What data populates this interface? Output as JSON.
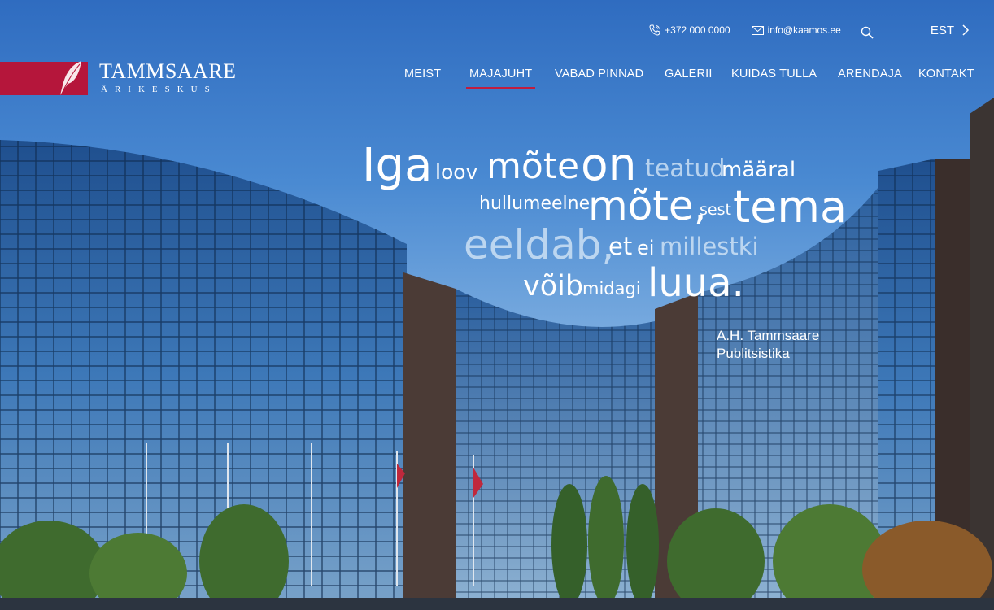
{
  "topbar": {
    "phone": "+372 000 0000",
    "email": "info@kaamos.ee",
    "language": "EST"
  },
  "logo": {
    "title": "TAMMSAARE",
    "subtitle": "ÄRIKESKUS",
    "accent_color": "#b5163b"
  },
  "nav": {
    "items": [
      {
        "label": "MEIST",
        "active": false
      },
      {
        "label": "MAJAJUHT",
        "active": true
      },
      {
        "label": "VABAD PINNAD",
        "active": false
      },
      {
        "label": "GALERII",
        "active": false
      },
      {
        "label": "KUIDAS TULLA",
        "active": false
      },
      {
        "label": "ARENDAJA",
        "active": false
      },
      {
        "label": "KONTAKT",
        "active": false
      }
    ]
  },
  "quote": {
    "words": [
      "Iga",
      "loov",
      "mõte",
      "on",
      "teatud",
      "määral",
      "hullumeelne",
      "mõte,",
      "sest",
      "tema",
      "eeldab,",
      "et",
      "ei",
      "millestki",
      "võib",
      "midagi",
      "luua."
    ],
    "author": "A.H. Tammsaare",
    "source": "Publitsistika"
  },
  "icons": {
    "phone": "phone-icon",
    "email": "envelope-icon",
    "search": "search-icon",
    "language_next": "chevron-right-icon"
  }
}
